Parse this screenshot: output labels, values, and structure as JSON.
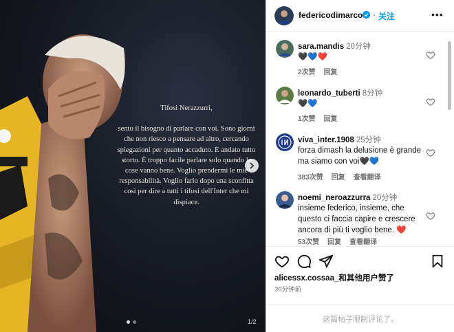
{
  "post": {
    "caption_greeting": "Tifosi Nerazzurri,",
    "caption_body": "sento il bisogno di parlare con voi. Sono giorni che non riesco a pensare ad altro, cercando spiegazioni per quanto accaduto. È andato tutto storto. È troppo facile parlare solo quando le cose vanno bene. Voglio prendermi le mie responsabilità. Voglio farlo dopo una sconfitta così per dire a tutti i tifosi dell'Inter che mi dispiace.",
    "slide_counter": "1/2",
    "slides_total": 2,
    "slide_active_index": 0
  },
  "header": {
    "username": "federicodimarco",
    "separator": "·",
    "follow_label": "关注",
    "more_label": "•••"
  },
  "comments": [
    {
      "user": "sara.mandis",
      "time": "20分钟",
      "text": "🖤💙❤️",
      "likes": "2次赞",
      "reply": "回复",
      "translate": ""
    },
    {
      "user": "leonardo_tuberti",
      "time": "8分钟",
      "text": "🖤💙",
      "likes": "1次赞",
      "reply": "回复",
      "translate": ""
    },
    {
      "user": "viva_inter.1908",
      "time": "25分钟",
      "text": "forza dimash la delusione è grande ma siamo con voi🖤💙",
      "likes": "383次赞",
      "reply": "回复",
      "translate": "查看翻译"
    },
    {
      "user": "noemi_neroazzurra",
      "time": "20分钟",
      "text": "insieme federico, insieme, che questo ci faccia capire e crescere ancora di più ti voglio bene. ❤️",
      "likes": "53次赞",
      "reply": "回复",
      "translate": "查看翻译"
    }
  ],
  "footer": {
    "liked_by_user": "alicessx.cossaa_",
    "liked_by_suffix": "和其他用户赞了",
    "posted_time": "36分钟前",
    "comments_restricted": "这篇帖子限制评论了。"
  },
  "colors": {
    "accent_blue": "#0095f6",
    "inter_blue": "#1e3a8a",
    "jersey_yellow": "#f2c230"
  }
}
